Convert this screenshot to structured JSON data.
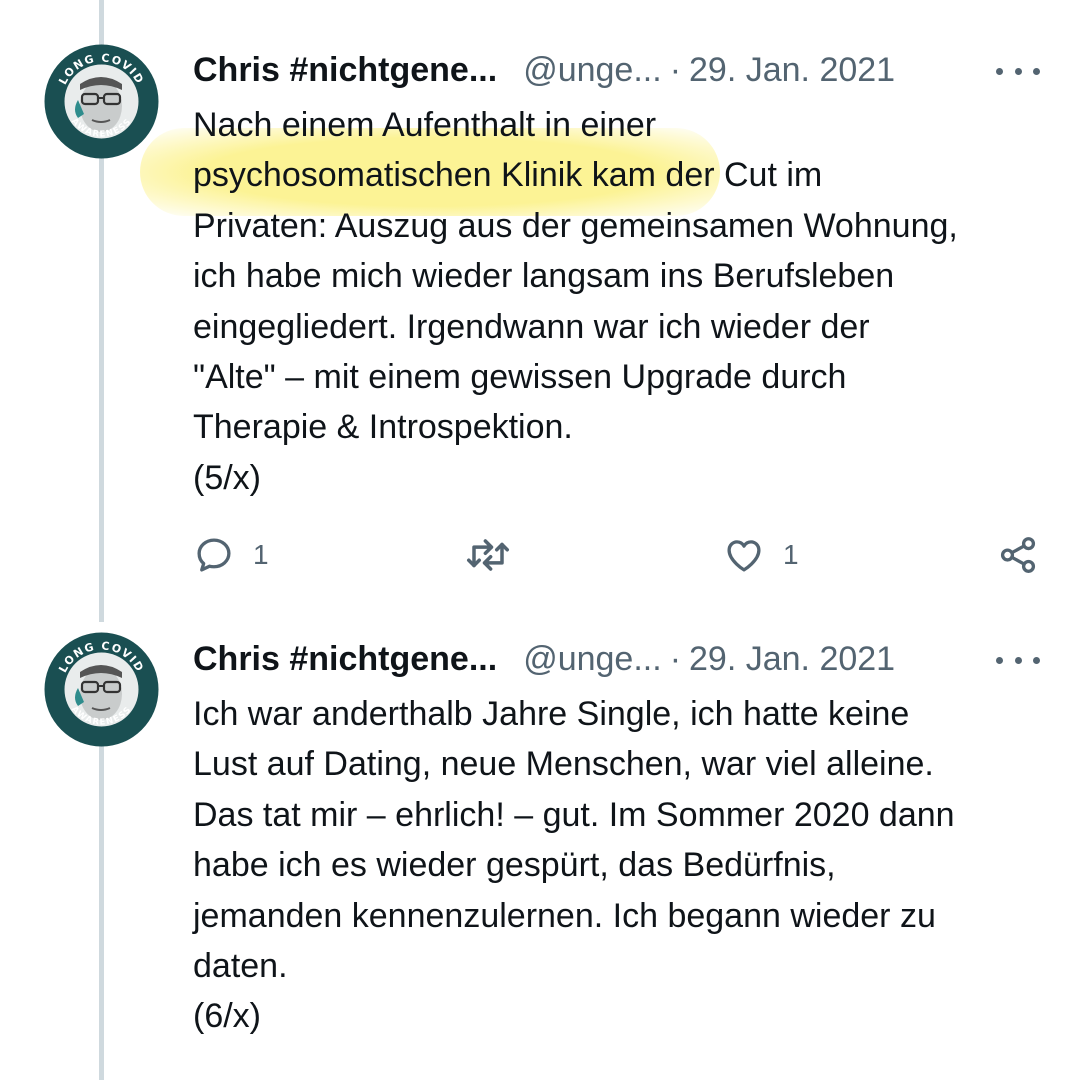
{
  "tweets": [
    {
      "author_name": "Chris #nichtgene...",
      "handle": "@unge...",
      "separator": "·",
      "date": "29. Jan. 2021",
      "avatar_badge": "LONG COVID AWARENESS",
      "lines": [
        "Nach einem Aufenthalt in einer",
        "psychosomatischen Klinik kam der Cut im",
        "Privaten: Auszug aus der gemeinsamen Wohnung,",
        "ich habe mich wieder langsam ins Berufsleben",
        "eingegliedert. Irgendwann war ich wieder der",
        "\"Alte\" – mit einem gewissen Upgrade durch",
        "Therapie & Introspektion.",
        "(5/x)"
      ],
      "highlighted_text": "psychosomatischen Klinik kam",
      "actions": {
        "reply_icon": "reply-icon",
        "reply_count": "1",
        "retweet_icon": "retweet-icon",
        "retweet_count": "",
        "like_icon": "heart-icon",
        "like_count": "1",
        "share_icon": "share-icon"
      }
    },
    {
      "author_name": "Chris #nichtgene...",
      "handle": "@unge...",
      "separator": "·",
      "date": "29. Jan. 2021",
      "avatar_badge": "LONG COVID AWARENESS",
      "lines": [
        "Ich war anderthalb Jahre Single, ich hatte keine",
        "Lust auf Dating, neue Menschen, war viel alleine.",
        "Das tat mir – ehrlich! – gut. Im Sommer 2020 dann",
        "habe ich es wieder gespürt, das Bedürfnis,",
        "jemanden kennenzulernen. Ich begann wieder zu",
        "daten.",
        "(6/x)"
      ]
    }
  ],
  "colors": {
    "text": "#0f1419",
    "secondary": "#536471",
    "thread_line": "#cfd9de",
    "highlight": "#fcf28c",
    "avatar_ring": "#1a4f52"
  }
}
